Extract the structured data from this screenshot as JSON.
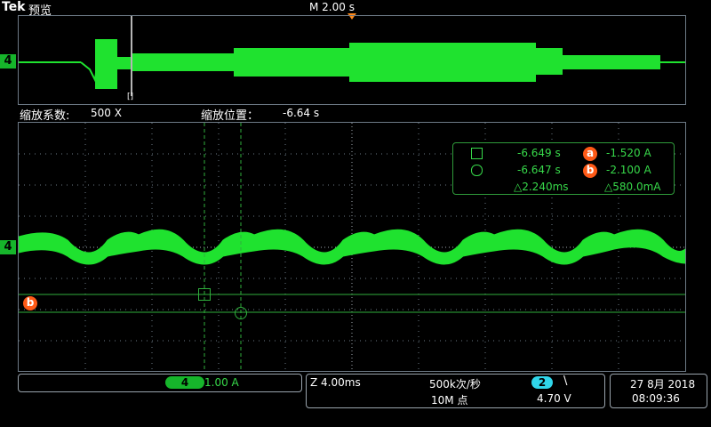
{
  "header": {
    "brand": "Tek",
    "mode_label": "预览",
    "timebase": "M 2.00 s"
  },
  "overview": {
    "channel_marker": "4",
    "zoom_bracket": "[]"
  },
  "zoom_info": {
    "zoom_factor_label": "缩放系数:",
    "zoom_factor_value": "500 X",
    "zoom_position_label": "缩放位置：",
    "zoom_position_value": "-6.64 s"
  },
  "main": {
    "channel_marker": "4",
    "cursor_b_marker": "b"
  },
  "cursor_readout": {
    "row1_time": "-6.649 s",
    "row1_badge": "a",
    "row1_value": "-1.520 A",
    "row2_time": "-6.647 s",
    "row2_badge": "b",
    "row2_value": "-2.100 A",
    "delta_time": "△2.240ms",
    "delta_value": "△580.0mA"
  },
  "status": {
    "channel_badge": "4",
    "channel_scale": "1.00 A",
    "zoom_time": "Z 4.00ms",
    "sample_rate": "500k次/秒",
    "record_length": "10M 点",
    "trigger_channel": "2",
    "trigger_slope": "\\",
    "trigger_level": "4.70 V",
    "date": "27 8月 2018",
    "time": "08:09:36"
  },
  "colors": {
    "trace": "#1fe22f",
    "grid": "#6d7a86",
    "cursor": "#2fae3c",
    "accent_orange": "#ff5a17",
    "trigger_cyan": "#30d6ea"
  }
}
